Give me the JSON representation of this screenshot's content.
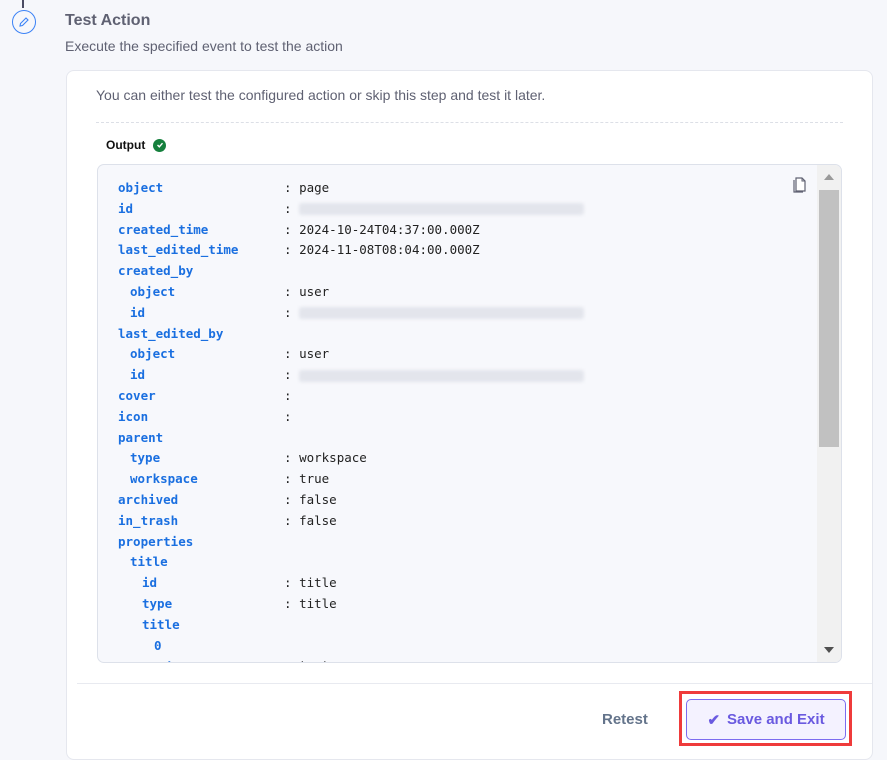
{
  "header": {
    "title": "Test Action",
    "subtitle": "Execute the specified event to test the action"
  },
  "card": {
    "hint": "You can either test the configured action or skip this step and test it later.",
    "output_label": "Output"
  },
  "output_rows": [
    {
      "key": "object",
      "indent": 0,
      "value": "page"
    },
    {
      "key": "id",
      "indent": 0,
      "blurred": true
    },
    {
      "key": "created_time",
      "indent": 0,
      "value": "2024-10-24T04:37:00.000Z"
    },
    {
      "key": "last_edited_time",
      "indent": 0,
      "value": "2024-11-08T08:04:00.000Z"
    },
    {
      "key": "created_by",
      "indent": 0,
      "group": true
    },
    {
      "key": "object",
      "indent": 1,
      "value": "user"
    },
    {
      "key": "id",
      "indent": 1,
      "blurred": true
    },
    {
      "key": "last_edited_by",
      "indent": 0,
      "group": true
    },
    {
      "key": "object",
      "indent": 1,
      "value": "user"
    },
    {
      "key": "id",
      "indent": 1,
      "blurred": true
    },
    {
      "key": "cover",
      "indent": 0,
      "value": ""
    },
    {
      "key": "icon",
      "indent": 0,
      "value": ""
    },
    {
      "key": "parent",
      "indent": 0,
      "group": true
    },
    {
      "key": "type",
      "indent": 1,
      "value": "workspace"
    },
    {
      "key": "workspace",
      "indent": 1,
      "value": "true"
    },
    {
      "key": "archived",
      "indent": 0,
      "value": "false"
    },
    {
      "key": "in_trash",
      "indent": 0,
      "value": "false"
    },
    {
      "key": "properties",
      "indent": 0,
      "group": true
    },
    {
      "key": "title",
      "indent": 1,
      "group": true
    },
    {
      "key": "id",
      "indent": 2,
      "value": "title"
    },
    {
      "key": "type",
      "indent": 2,
      "value": "title"
    },
    {
      "key": "title",
      "indent": 2,
      "group": true
    },
    {
      "key": "0",
      "indent": 3,
      "group": true
    },
    {
      "key": "type",
      "indent": 4,
      "value": "text"
    }
  ],
  "footer": {
    "retest_label": "Retest",
    "save_label": "Save and Exit"
  },
  "colors": {
    "accent": "#6a5ae0",
    "key": "#1a6fe0",
    "success": "#15803d",
    "highlight": "#ef3b3b"
  }
}
